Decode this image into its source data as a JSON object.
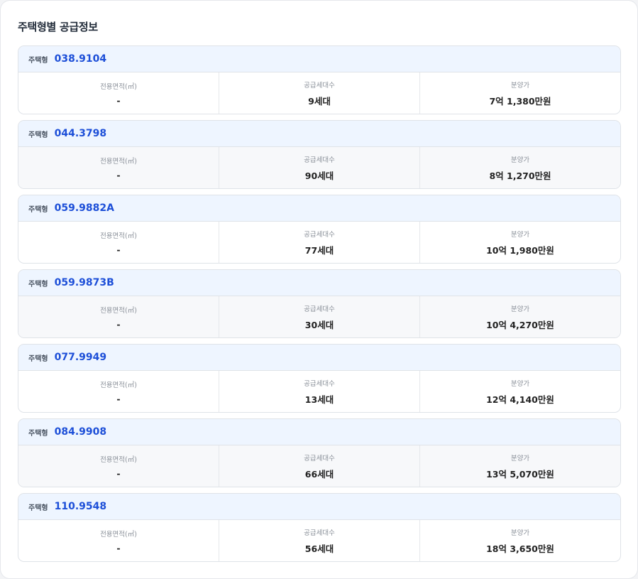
{
  "title": "주택형별 공급정보",
  "labels": {
    "type": "주택형",
    "area": "전용면적(㎡)",
    "units": "공급세대수",
    "price": "분양가"
  },
  "types": [
    {
      "code": "038.9104",
      "area": "-",
      "units": "9세대",
      "price": "7억 1,380만원"
    },
    {
      "code": "044.3798",
      "area": "-",
      "units": "90세대",
      "price": "8억 1,270만원"
    },
    {
      "code": "059.9882A",
      "area": "-",
      "units": "77세대",
      "price": "10억 1,980만원"
    },
    {
      "code": "059.9873B",
      "area": "-",
      "units": "30세대",
      "price": "10억 4,270만원"
    },
    {
      "code": "077.9949",
      "area": "-",
      "units": "13세대",
      "price": "12억 4,140만원"
    },
    {
      "code": "084.9908",
      "area": "-",
      "units": "66세대",
      "price": "13억 5,070만원"
    },
    {
      "code": "110.9548",
      "area": "-",
      "units": "56세대",
      "price": "18억 3,650만원"
    }
  ]
}
